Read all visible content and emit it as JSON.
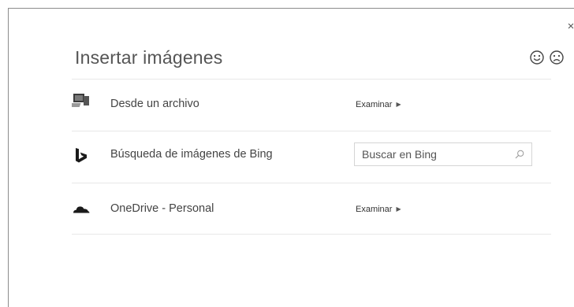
{
  "dialog": {
    "title": "Insertar imágenes",
    "close_glyph": "×",
    "feedback": [
      "smile-icon",
      "frown-icon"
    ]
  },
  "sources": {
    "file": {
      "icon": "computer-icon",
      "label": "Desde un archivo",
      "action": "Examinar",
      "action_arrow": "▶"
    },
    "bing": {
      "icon": "bing-icon",
      "label": "Búsqueda de imágenes de Bing",
      "search_placeholder": "Buscar en Bing",
      "search_value": "",
      "search_icon": "search-icon"
    },
    "onedrive": {
      "icon": "onedrive-cloud-icon",
      "label": "OneDrive - Personal",
      "action": "Examinar",
      "action_arrow": "▶"
    }
  },
  "colors": {
    "text": "#444444",
    "divider": "#e8e8e8",
    "border": "#8c8c8c"
  }
}
